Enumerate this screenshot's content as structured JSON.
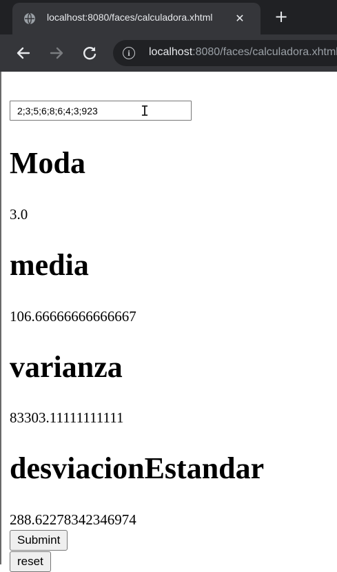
{
  "browser": {
    "tab_title": "localhost:8080/faces/calculadora.xhtml",
    "close_glyph": "✕",
    "new_tab_glyph": "+",
    "url_host": "localhost",
    "url_path": ":8080/faces/calculadora.xhtml",
    "icons": [
      "globe-icon",
      "close-icon",
      "plus-icon",
      "back-arrow-icon",
      "forward-arrow-icon",
      "reload-icon",
      "info-icon"
    ]
  },
  "form": {
    "input_value": "2;3;5;6;8;6;4;3;923",
    "submit_label": "Submint",
    "reset_label": "reset"
  },
  "stats": {
    "moda_label": "Moda",
    "moda_value": "3.0",
    "media_label": "media",
    "media_value": "106.66666666666667",
    "varianza_label": "varianza",
    "varianza_value": "83303.11111111111",
    "desviacion_label": "desviacionEstandar",
    "desviacion_value": "288.62278342346974"
  }
}
